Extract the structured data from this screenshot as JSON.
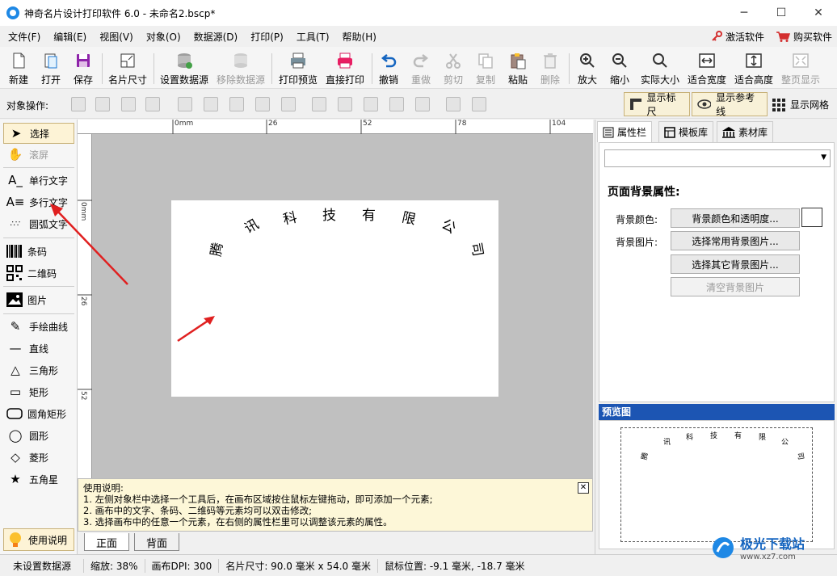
{
  "window": {
    "title": "神奇名片设计打印软件 6.0 - 未命名2.bscp*"
  },
  "menu": {
    "items": [
      "文件(F)",
      "编辑(E)",
      "视图(V)",
      "对象(O)",
      "数据源(D)",
      "打印(P)",
      "工具(T)",
      "帮助(H)"
    ],
    "activate": "激活软件",
    "buy": "购买软件"
  },
  "toolbar": {
    "new": "新建",
    "open": "打开",
    "save": "保存",
    "card_size": "名片尺寸",
    "set_datasource": "设置数据源",
    "remove_datasource": "移除数据源",
    "print_preview": "打印预览",
    "direct_print": "直接打印",
    "undo": "撤销",
    "redo": "重做",
    "cut": "剪切",
    "copy": "复制",
    "paste": "粘贴",
    "delete": "删除",
    "zoom_in": "放大",
    "zoom_out": "缩小",
    "actual_size": "实际大小",
    "fit_width": "适合宽度",
    "fit_height": "适合高度",
    "fit_page": "整页显示"
  },
  "objbar": {
    "label": "对象操作:",
    "show_ruler": "显示标尺",
    "show_guides": "显示参考线",
    "show_grid": "显示网格"
  },
  "tools": {
    "select": "选择",
    "scroll": "滚屏",
    "single_text": "单行文字",
    "multi_text": "多行文字",
    "arc_text": "圆弧文字",
    "barcode": "条码",
    "qrcode": "二维码",
    "image": "图片",
    "freehand": "手绘曲线",
    "line": "直线",
    "triangle": "三角形",
    "rect": "矩形",
    "round_rect": "圆角矩形",
    "circle": "圆形",
    "diamond": "菱形",
    "star": "五角星",
    "help": "使用说明"
  },
  "ruler": {
    "h": [
      "0mm",
      "26",
      "52",
      "78",
      "104"
    ],
    "v": [
      "0mm",
      "26",
      "52"
    ]
  },
  "card": {
    "chars": [
      "腾",
      "讯",
      "科",
      "技",
      "有",
      "限",
      "公",
      "司"
    ]
  },
  "help": {
    "title": "使用说明:",
    "lines": [
      "1. 左侧对象栏中选择一个工具后，在画布区域按住鼠标左键拖动，即可添加一个元素;",
      "2. 画布中的文字、条码、二维码等元素均可以双击修改;",
      "3. 选择画布中的任意一个元素，在右侧的属性栏里可以调整该元素的属性。"
    ]
  },
  "pagetabs": {
    "front": "正面",
    "back": "背面"
  },
  "right": {
    "tab_props": "属性栏",
    "tab_templates": "模板库",
    "tab_assets": "素材库",
    "section_title": "页面背景属性:",
    "bg_color_label": "背景颜色:",
    "bg_image_label": "背景图片:",
    "btn_color": "背景颜色和透明度...",
    "btn_common": "选择常用背景图片...",
    "btn_other": "选择其它背景图片...",
    "btn_clear": "清空背景图片",
    "preview_title": "预览图"
  },
  "status": {
    "datasource": "未设置数据源",
    "zoom": "缩放: 38%",
    "dpi": "画布DPI: 300",
    "size": "名片尺寸: 90.0 毫米 x 54.0 毫米",
    "mouse": "鼠标位置: -9.1 毫米, -18.7 毫米"
  },
  "watermark": {
    "text": "极光下载站",
    "url": "www.xz7.com"
  }
}
